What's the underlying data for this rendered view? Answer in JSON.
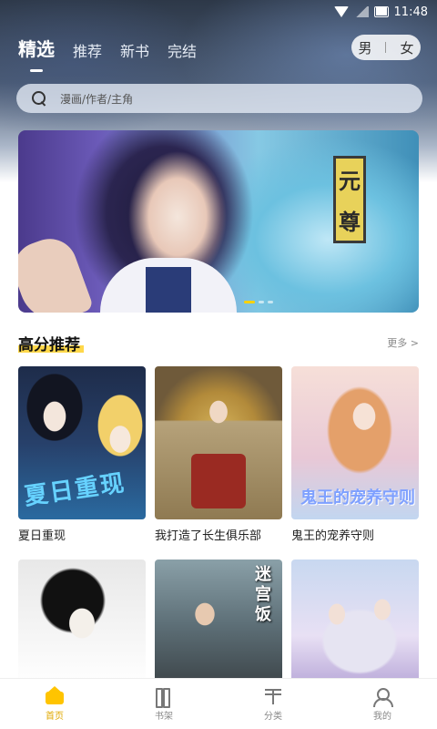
{
  "status_bar": {
    "time": "11:48"
  },
  "top_tabs": [
    {
      "label": "精选",
      "active": true
    },
    {
      "label": "推荐",
      "active": false
    },
    {
      "label": "新书",
      "active": false
    },
    {
      "label": "完结",
      "active": false
    }
  ],
  "gender_toggle": {
    "male": "男",
    "female": "女"
  },
  "search": {
    "placeholder": "漫画/作者/主角"
  },
  "banner": {
    "title_chars": [
      "元",
      "尊"
    ]
  },
  "section": {
    "title": "高分推荐",
    "more": "更多 >"
  },
  "books": [
    {
      "title": "夏日重现",
      "cover_text": "夏日重现"
    },
    {
      "title": "我打造了长生俱乐部"
    },
    {
      "title": "鬼王的宠养守则",
      "cover_text": "鬼王的宠养守则"
    },
    {
      "title": ""
    },
    {
      "title": "",
      "cover_text": "迷宫饭"
    },
    {
      "title": ""
    }
  ],
  "bottom_nav": [
    {
      "label": "首页",
      "icon": "home-icon",
      "active": true
    },
    {
      "label": "书架",
      "icon": "bookshelf-icon",
      "active": false
    },
    {
      "label": "分类",
      "icon": "category-icon",
      "active": false
    },
    {
      "label": "我的",
      "icon": "profile-icon",
      "active": false
    }
  ],
  "colors": {
    "accent": "#ffc400",
    "highlight": "#ffd84a"
  }
}
